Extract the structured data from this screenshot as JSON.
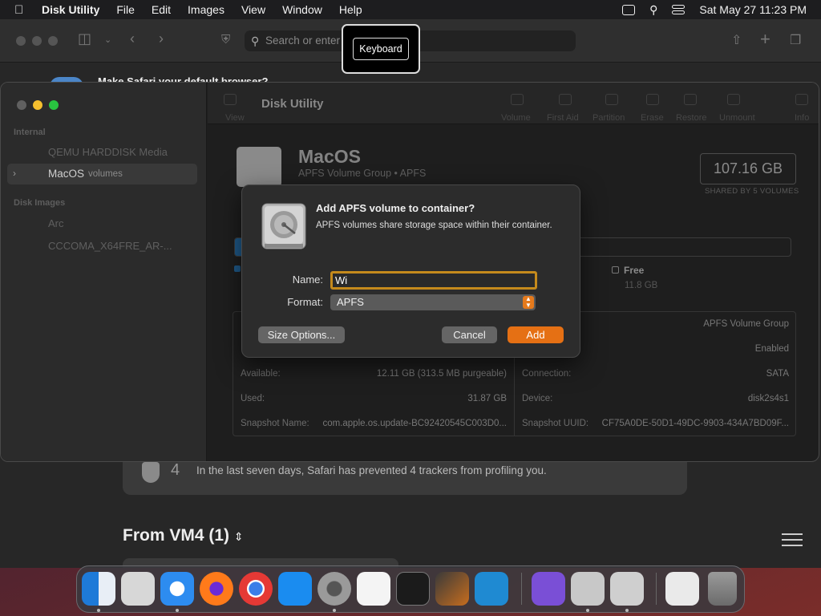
{
  "menubar": {
    "app_name": "Disk Utility",
    "items": [
      "File",
      "Edit",
      "Images",
      "View",
      "Window",
      "Help"
    ],
    "clock": "Sat May 27  11:23 PM"
  },
  "safari": {
    "search_placeholder": "Search or enter",
    "banner": "Make Safari your default browser?",
    "privacy_count": "4",
    "privacy_message": "In the last seven days, Safari has prevented 4 trackers from profiling you.",
    "section_title": "From VM4 (1)"
  },
  "keyboard_hud": {
    "label": "Keyboard"
  },
  "disk_utility": {
    "toolbar": {
      "title": "Disk Utility",
      "view_label": "View",
      "buttons": [
        "Volume",
        "First Aid",
        "Partition",
        "Erase",
        "Restore",
        "Unmount",
        "Info"
      ]
    },
    "sidebar": {
      "internal_header": "Internal",
      "disk_images_header": "Disk Images",
      "internal_items": [
        "QEMU HARDDISK Media"
      ],
      "selected_name": "MacOS",
      "selected_sub": "volumes",
      "disk_image_items": [
        "Arc",
        "CCCOMA_X64FRE_AR-..."
      ]
    },
    "volume": {
      "name": "MacOS",
      "subtitle": "APFS Volume Group • APFS",
      "size": "107.16 GB",
      "size_note": "SHARED BY 5 VOLUMES",
      "free_label": "Free",
      "free_value": "11.8 GB",
      "used_fraction": 0.62
    },
    "info_left": [
      {
        "key": "Available:",
        "value": "12.11 GB (313.5 MB purgeable)"
      },
      {
        "key": "Used:",
        "value": "31.87 GB"
      },
      {
        "key": "Snapshot Name:",
        "value": "com.apple.os.update-BC92420545C003D0..."
      }
    ],
    "info_right": [
      {
        "key": "",
        "value": "APFS Volume Group"
      },
      {
        "key": "",
        "value": "Enabled"
      },
      {
        "key": "Connection:",
        "value": "SATA"
      },
      {
        "key": "Device:",
        "value": "disk2s4s1"
      },
      {
        "key": "Snapshot UUID:",
        "value": "CF75A0DE-50D1-49DC-9903-434A7BD09F..."
      }
    ]
  },
  "dialog": {
    "title": "Add APFS volume to container?",
    "message": "APFS volumes share storage space within their container.",
    "name_label": "Name:",
    "name_value": "Wi",
    "format_label": "Format:",
    "format_value": "APFS",
    "size_options_label": "Size Options...",
    "cancel_label": "Cancel",
    "add_label": "Add"
  },
  "dock": {
    "apps": [
      "finder-icon",
      "launchpad-icon",
      "safari-icon",
      "firefox-icon",
      "chrome-icon",
      "app-store-icon",
      "system-settings-icon",
      "textedit-icon",
      "terminal-icon",
      "garageband-icon",
      "vscode-icon",
      "visual-studio-icon",
      "boot-camp-icon",
      "disk-utility-icon",
      "downloads-stack-icon",
      "trash-icon"
    ]
  },
  "colors": {
    "accent_orange": "#e57014",
    "focus_ring": "#c58a1c",
    "used_blue": "#1f5a8a"
  }
}
